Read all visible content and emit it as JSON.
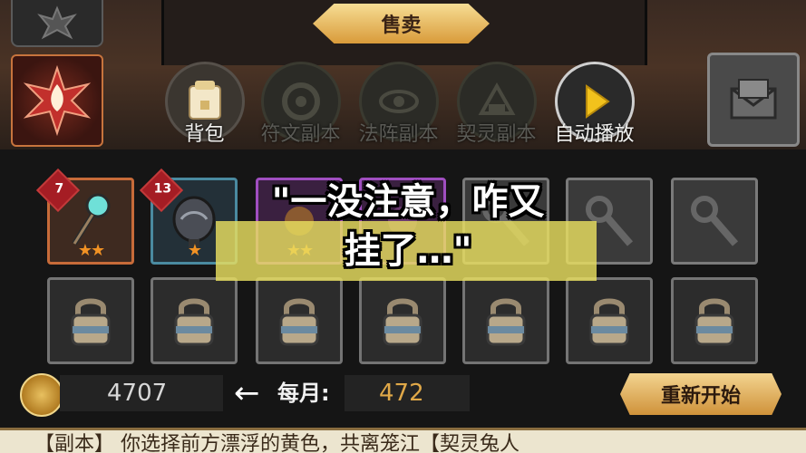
{
  "header": {
    "sell_label": "售卖"
  },
  "tabs": [
    {
      "label": "背包",
      "icon": "backpack-icon",
      "state": "active"
    },
    {
      "label": "符文副本",
      "icon": "rune-icon",
      "state": "disabled"
    },
    {
      "label": "法阵副本",
      "icon": "eye-icon",
      "state": "disabled"
    },
    {
      "label": "契灵副本",
      "icon": "spirit-icon",
      "state": "disabled"
    },
    {
      "label": "自动播放",
      "icon": "play-icon",
      "state": "enabled"
    }
  ],
  "inventory": {
    "row1": [
      {
        "level": "7",
        "stars": "★★",
        "frame": "orange",
        "icon": "staff-icon"
      },
      {
        "level": "13",
        "stars": "★",
        "frame": "teal",
        "icon": "orb-icon"
      },
      {
        "level": "",
        "stars": "★★",
        "frame": "purple",
        "icon": "item-icon"
      },
      {
        "level": "",
        "stars": "",
        "frame": "purple",
        "icon": "item-icon"
      },
      {
        "level": "",
        "stars": "",
        "frame": "grey",
        "icon": "staff-placeholder-icon"
      },
      {
        "level": "",
        "stars": "",
        "frame": "grey",
        "icon": "staff-placeholder-icon"
      },
      {
        "level": "",
        "stars": "",
        "frame": "grey",
        "icon": "staff-placeholder-icon"
      }
    ],
    "row2_locked_count": 7
  },
  "currency": {
    "gold": "4707",
    "monthly_label": "每月:",
    "monthly_value": "472"
  },
  "restart_label": "重新开始",
  "log_text": "【副本】  你选择前方漂浮的黄色，共离笼江【契灵兔人",
  "caption": {
    "line1": "\"一没注意，咋又",
    "line2": "挂了…\""
  },
  "colors": {
    "accent_gold": "#e0a848",
    "caption_band": "#e9df60"
  }
}
